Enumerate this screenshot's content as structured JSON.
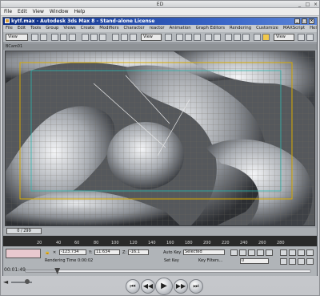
{
  "player": {
    "title": "ED",
    "menu": [
      "File",
      "Edit",
      "View",
      "Window",
      "Help"
    ],
    "current_time": "00:01:49",
    "progress_fraction": 0.11,
    "volume_fraction": 0.85,
    "controls": {
      "prev": "⏮",
      "rewind": "◀◀",
      "play": "▶",
      "forward": "▶▶",
      "next": "⏭"
    }
  },
  "max": {
    "title": "kytf.max - Autodesk 3ds Max 8 - Stand-alone License",
    "menu": [
      "File",
      "Edit",
      "Tools",
      "Group",
      "Views",
      "Create",
      "Modifiers",
      "Character",
      "reactor",
      "Animation",
      "Graph Editors",
      "Rendering",
      "Customize",
      "MAXScript",
      "Help"
    ],
    "toolbar": {
      "view_dropdown_left": "View",
      "view_dropdown_right": "View"
    },
    "viewport_label": "BCam01",
    "time_slider": "0 / 299",
    "track_ticks": [
      "20",
      "40",
      "60",
      "80",
      "100",
      "120",
      "140",
      "160",
      "180",
      "200",
      "220",
      "240",
      "260",
      "280"
    ],
    "status": {
      "x_value": "-123.734",
      "y_label": "Y:",
      "y_value": "11.634",
      "z_value": "-16.1",
      "auto_key": "Auto Key",
      "selected": "Selected",
      "set_key": "Set Key",
      "key_filters": "Key Filters...",
      "render_time": "Rendering Time  0:00:02",
      "frame_value": "0"
    }
  }
}
